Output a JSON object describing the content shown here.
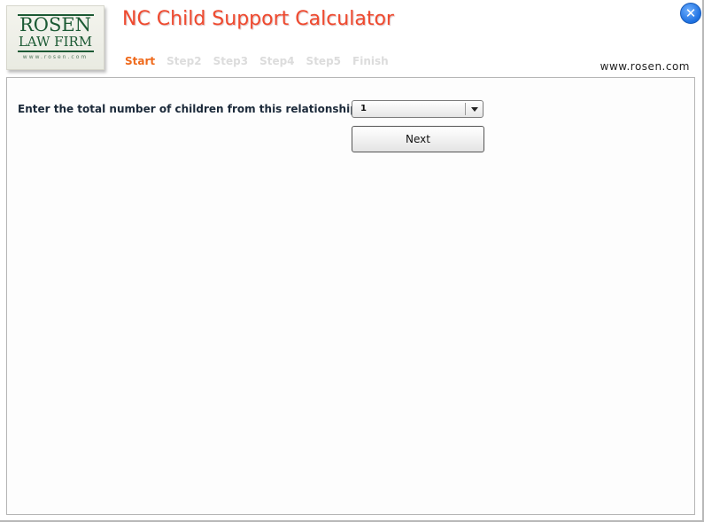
{
  "logo": {
    "line1": "ROSEN",
    "line2": "LAW FIRM",
    "url": "www.rosen.com"
  },
  "header": {
    "title": "NC Child Support Calculator",
    "website": "www.rosen.com",
    "close_icon": "✕",
    "steps": [
      {
        "label": "Start",
        "active": true
      },
      {
        "label": "Step2",
        "active": false
      },
      {
        "label": "Step3",
        "active": false
      },
      {
        "label": "Step4",
        "active": false
      },
      {
        "label": "Step5",
        "active": false
      },
      {
        "label": "Finish",
        "active": false
      }
    ]
  },
  "form": {
    "question": "Enter the total number of children from this relationship:",
    "children_select": {
      "value": "1"
    },
    "next_label": "Next"
  },
  "colors": {
    "title": "#ef4a2f",
    "active_step": "#ef6a1c",
    "inactive_step": "#dcdcdc",
    "logo_green": "#1c5a34",
    "close_blue": "#1c6fe0"
  }
}
